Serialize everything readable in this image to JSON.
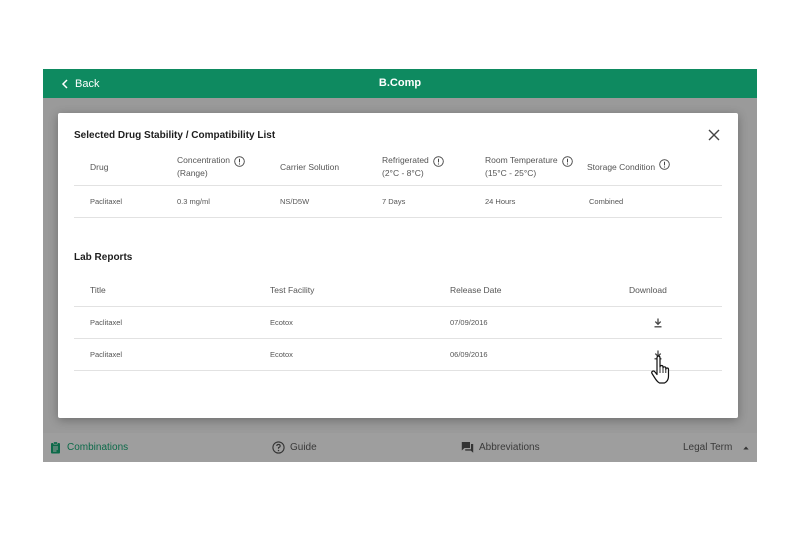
{
  "app": {
    "back_label": "Back",
    "title": "B.Comp"
  },
  "modal": {
    "title": "Selected Drug Stability / Compatibility List",
    "stability": {
      "headers": {
        "drug": "Drug",
        "concentration_l1": "Concentration",
        "concentration_l2": "(Range)",
        "carrier": "Carrier Solution",
        "refrigerated_l1": "Refrigerated",
        "refrigerated_l2": "(2°C - 8°C)",
        "room_l1": "Room Temperature",
        "room_l2": "(15°C - 25°C)",
        "storage": "Storage Condition"
      },
      "rows": [
        {
          "drug": "Paclitaxel",
          "concentration": "0.3 mg/ml",
          "carrier": "NS/D5W",
          "refrigerated": "7 Days",
          "room": "24 Hours",
          "storage": "Combined"
        }
      ]
    },
    "lab_reports": {
      "title": "Lab Reports",
      "headers": {
        "title": "Title",
        "facility": "Test Facility",
        "release": "Release Date",
        "download": "Download"
      },
      "rows": [
        {
          "title": "Paclitaxel",
          "facility": "Ecotox",
          "release": "07/09/2016"
        },
        {
          "title": "Paclitaxel",
          "facility": "Ecotox",
          "release": "06/09/2016"
        }
      ]
    }
  },
  "bottombar": {
    "combinations": "Combinations",
    "guide": "Guide",
    "abbreviations": "Abbreviations",
    "legal": "Legal Term"
  },
  "colors": {
    "brand_green": "#0e8a60",
    "overlay_gray": "#9a9a9a"
  },
  "icons": [
    "chevron-left-icon",
    "close-icon",
    "info-icon",
    "download-icon",
    "clipboard-icon",
    "help-circle-icon",
    "chat-icon",
    "caret-up-icon",
    "hand-cursor-icon"
  ]
}
